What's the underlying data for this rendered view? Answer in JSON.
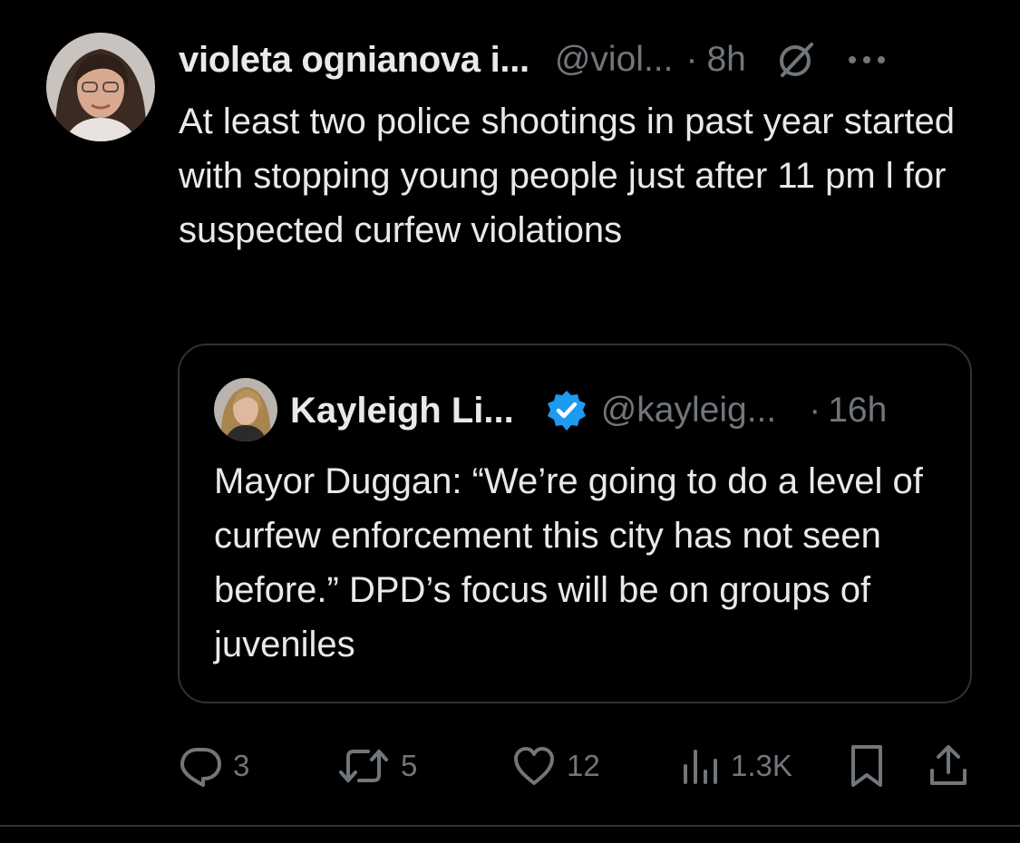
{
  "tweet": {
    "display_name": "violeta ognianova i...",
    "handle": "@viol...",
    "separator": "·",
    "time": "8h",
    "text": "At least two police shootings in past year started with stopping young people just after 11 pm l for suspected curfew violations",
    "icons": {
      "avatar": "profile-photo",
      "grok": "grok-slash-circle-icon",
      "more": "more-horizontal-icon"
    }
  },
  "quote": {
    "display_name": "Kayleigh Li...",
    "verified": true,
    "verified_color": "#1d9bf0",
    "handle": "@kayleig...",
    "separator": "·",
    "time": "16h",
    "text": "Mayor Duggan: “We’re going to do a level of curfew enforcement this city has not seen before.” DPD’s focus will be on groups of juveniles"
  },
  "actions": {
    "replies": "3",
    "reposts": "5",
    "likes": "12",
    "views": "1.3K"
  },
  "colors": {
    "background": "#000000",
    "text_primary": "#e7e9ea",
    "text_secondary": "#71767b",
    "border": "#2f3336",
    "verified_blue": "#1d9bf0"
  }
}
